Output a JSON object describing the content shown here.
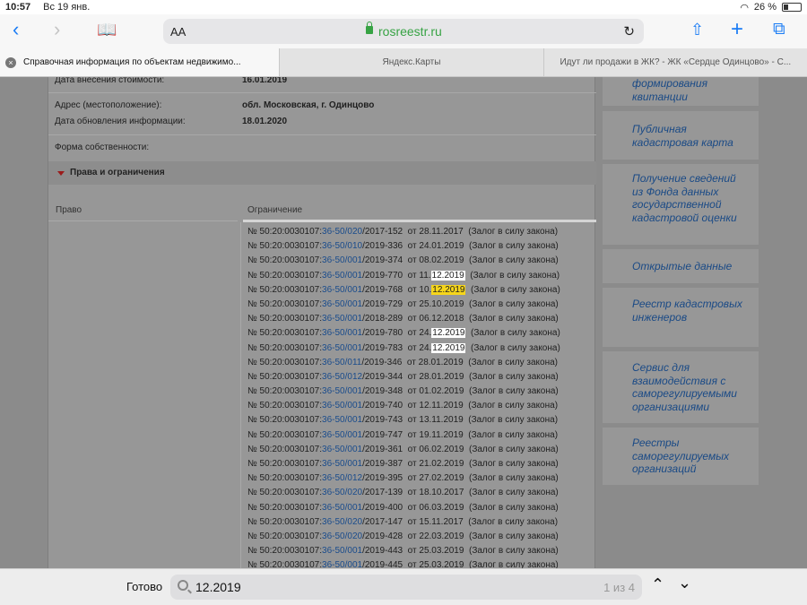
{
  "status": {
    "time": "10:57",
    "date": "Вс 19 янв.",
    "battery": "26 %"
  },
  "toolbar": {
    "text_size": "AA",
    "url": "rosreestr.ru",
    "back_icon": "chevron-left-icon",
    "forward_icon": "chevron-right-icon",
    "bookmarks_icon": "book-icon",
    "share_icon": "share-icon",
    "new_tab_icon": "plus-icon",
    "tabs_icon": "tabs-icon"
  },
  "tabs": [
    {
      "label": "Справочная информация по объектам недвижимо..."
    },
    {
      "label": "Яндекс.Карты"
    },
    {
      "label": "Идут ли продажи в ЖК? - ЖК «Сердце Одинцово» - С..."
    }
  ],
  "details": {
    "rows": [
      {
        "key": "Дата внесения стоимости:",
        "value": "16.01.2019"
      },
      {
        "key": "Адрес (местоположение):",
        "value": "обл. Московская, г. Одинцово"
      },
      {
        "key": "Дата обновления информации:",
        "value": "18.01.2020"
      },
      {
        "key": "Форма собственности:",
        "value": ""
      }
    ],
    "section_title": "Права и ограничения",
    "col_right": "Право",
    "col_restriction": "Ограничение"
  },
  "registrations": [
    {
      "prefix": "№ 50:20:0030107:",
      "link": "36-50/020",
      "suffix": "/2017-152",
      "date_pre": "  от 28.11.2017",
      "date_hl": "",
      "hl_type": "",
      "type": "  (Залог в силу закона)"
    },
    {
      "prefix": "№ 50:20:0030107:",
      "link": "36-50/010",
      "suffix": "/2019-336",
      "date_pre": "  от 24.01.2019",
      "date_hl": "",
      "hl_type": "",
      "type": "  (Залог в силу закона)"
    },
    {
      "prefix": "№ 50:20:0030107:",
      "link": "36-50/001",
      "suffix": "/2019-374",
      "date_pre": "  от 08.02.2019",
      "date_hl": "",
      "hl_type": "",
      "type": "  (Залог в силу закона)"
    },
    {
      "prefix": "№ 50:20:0030107:",
      "link": "36-50/001",
      "suffix": "/2019-770",
      "date_pre": "  от 11.",
      "date_hl": "12.2019",
      "hl_type": "match",
      "type": "  (Залог в силу закона)"
    },
    {
      "prefix": "№ 50:20:0030107:",
      "link": "36-50/001",
      "suffix": "/2019-768",
      "date_pre": "  от 10.",
      "date_hl": "12.2019",
      "hl_type": "current",
      "type": "  (Залог в силу закона)"
    },
    {
      "prefix": "№ 50:20:0030107:",
      "link": "36-50/001",
      "suffix": "/2019-729",
      "date_pre": "  от 25.10.2019",
      "date_hl": "",
      "hl_type": "",
      "type": "  (Залог в силу закона)"
    },
    {
      "prefix": "№ 50:20:0030107:",
      "link": "36-50/001",
      "suffix": "/2018-289",
      "date_pre": "  от 06.12.2018",
      "date_hl": "",
      "hl_type": "",
      "type": "  (Залог в силу закона)"
    },
    {
      "prefix": "№ 50:20:0030107:",
      "link": "36-50/001",
      "suffix": "/2019-780",
      "date_pre": "  от 24.",
      "date_hl": "12.2019",
      "hl_type": "match",
      "type": "  (Залог в силу закона)"
    },
    {
      "prefix": "№ 50:20:0030107:",
      "link": "36-50/001",
      "suffix": "/2019-783",
      "date_pre": "  от 24.",
      "date_hl": "12.2019",
      "hl_type": "match",
      "type": "  (Залог в силу закона)"
    },
    {
      "prefix": "№ 50:20:0030107:",
      "link": "36-50/011",
      "suffix": "/2019-346",
      "date_pre": "  от 28.01.2019",
      "date_hl": "",
      "hl_type": "",
      "type": "  (Залог в силу закона)"
    },
    {
      "prefix": "№ 50:20:0030107:",
      "link": "36-50/012",
      "suffix": "/2019-344",
      "date_pre": "  от 28.01.2019",
      "date_hl": "",
      "hl_type": "",
      "type": "  (Залог в силу закона)"
    },
    {
      "prefix": "№ 50:20:0030107:",
      "link": "36-50/001",
      "suffix": "/2019-348",
      "date_pre": "  от 01.02.2019",
      "date_hl": "",
      "hl_type": "",
      "type": "  (Залог в силу закона)"
    },
    {
      "prefix": "№ 50:20:0030107:",
      "link": "36-50/001",
      "suffix": "/2019-740",
      "date_pre": "  от 12.11.2019",
      "date_hl": "",
      "hl_type": "",
      "type": "  (Залог в силу закона)"
    },
    {
      "prefix": "№ 50:20:0030107:",
      "link": "36-50/001",
      "suffix": "/2019-743",
      "date_pre": "  от 13.11.2019",
      "date_hl": "",
      "hl_type": "",
      "type": "  (Залог в силу закона)"
    },
    {
      "prefix": "№ 50:20:0030107:",
      "link": "36-50/001",
      "suffix": "/2019-747",
      "date_pre": "  от 19.11.2019",
      "date_hl": "",
      "hl_type": "",
      "type": "  (Залог в силу закона)"
    },
    {
      "prefix": "№ 50:20:0030107:",
      "link": "36-50/001",
      "suffix": "/2019-361",
      "date_pre": "  от 06.02.2019",
      "date_hl": "",
      "hl_type": "",
      "type": "  (Залог в силу закона)"
    },
    {
      "prefix": "№ 50:20:0030107:",
      "link": "36-50/001",
      "suffix": "/2019-387",
      "date_pre": "  от 21.02.2019",
      "date_hl": "",
      "hl_type": "",
      "type": "  (Залог в силу закона)"
    },
    {
      "prefix": "№ 50:20:0030107:",
      "link": "36-50/012",
      "suffix": "/2019-395",
      "date_pre": "  от 27.02.2019",
      "date_hl": "",
      "hl_type": "",
      "type": "  (Залог в силу закона)"
    },
    {
      "prefix": "№ 50:20:0030107:",
      "link": "36-50/020",
      "suffix": "/2017-139",
      "date_pre": "  от 18.10.2017",
      "date_hl": "",
      "hl_type": "",
      "type": "  (Залог в силу закона)"
    },
    {
      "prefix": "№ 50:20:0030107:",
      "link": "36-50/001",
      "suffix": "/2019-400",
      "date_pre": "  от 06.03.2019",
      "date_hl": "",
      "hl_type": "",
      "type": "  (Залог в силу закона)"
    },
    {
      "prefix": "№ 50:20:0030107:",
      "link": "36-50/020",
      "suffix": "/2017-147",
      "date_pre": "  от 15.11.2017",
      "date_hl": "",
      "hl_type": "",
      "type": "  (Залог в силу закона)"
    },
    {
      "prefix": "№ 50:20:0030107:",
      "link": "36-50/020",
      "suffix": "/2019-428",
      "date_pre": "  от 22.03.2019",
      "date_hl": "",
      "hl_type": "",
      "type": "  (Залог в силу закона)"
    },
    {
      "prefix": "№ 50:20:0030107:",
      "link": "36-50/001",
      "suffix": "/2019-443",
      "date_pre": "  от 25.03.2019",
      "date_hl": "",
      "hl_type": "",
      "type": "  (Залог в силу закона)"
    },
    {
      "prefix": "№ 50:20:0030107:",
      "link": "36-50/001",
      "suffix": "/2019-445",
      "date_pre": "  от 25.03.2019",
      "date_hl": "",
      "hl_type": "",
      "type": "  (Залог в силу закона)"
    }
  ],
  "sidebar": [
    {
      "label": "формирования квитанции"
    },
    {
      "label": "Публичная кадастровая карта"
    },
    {
      "label": "Получение сведений из Фонда данных государственной кадастровой оценки"
    },
    {
      "label": "Открытые данные"
    },
    {
      "label": "Реестр кадастровых инженеров"
    },
    {
      "label": "Сервис для взаимодействия с саморегулируемыми организациями"
    },
    {
      "label": "Реестры саморегулируемых организаций"
    }
  ],
  "find": {
    "done": "Готово",
    "query": "12.2019",
    "count": "1 из 4"
  },
  "colors": {
    "link": "#1a4c8c",
    "match_highlight": "#ffffff",
    "current_highlight": "#f6d61a",
    "sidebar_link": "#1a4a86",
    "url": "#37a344",
    "accent": "#1a7cf5"
  }
}
